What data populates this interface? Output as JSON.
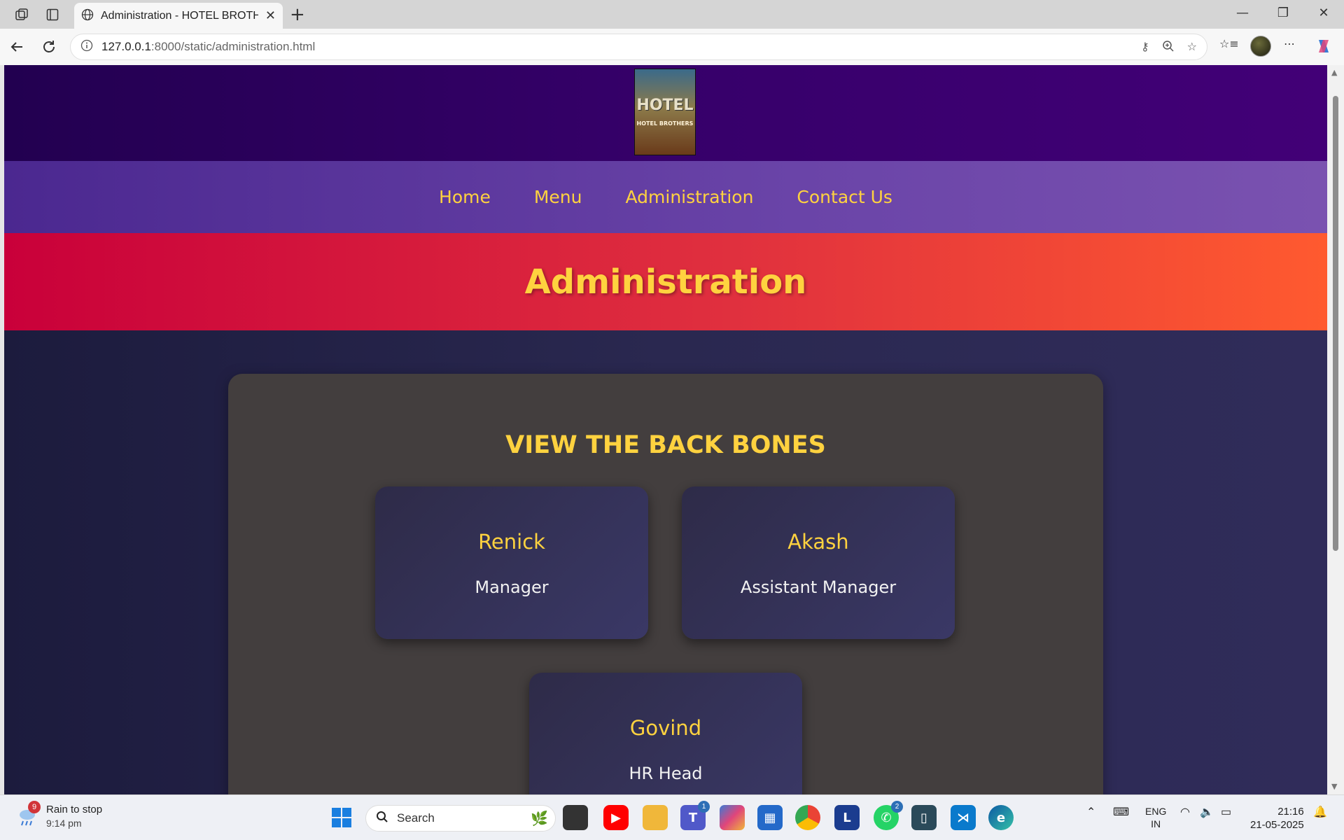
{
  "browser": {
    "tab_title": "Administration - HOTEL BROTHERS",
    "url_host": "127.0.0.1",
    "url_rest": ":8000/static/administration.html"
  },
  "site": {
    "logo_big": "HOTEL",
    "logo_small": "HOTEL BROTHERS",
    "nav": [
      "Home",
      "Menu",
      "Administration",
      "Contact Us"
    ],
    "banner_title": "Administration",
    "section_title": "VIEW THE BACK BONES",
    "team": [
      {
        "name": "Renick",
        "role": "Manager"
      },
      {
        "name": "Akash",
        "role": "Assistant Manager"
      },
      {
        "name": "Govind",
        "role": "HR Head"
      }
    ],
    "colors": {
      "accent_yellow": "#ffd23f",
      "header_purple": "#36006a",
      "nav_purple": "#6a44a8",
      "banner_red": "#e0303e",
      "panel_bg": "#433e3e"
    }
  },
  "taskbar": {
    "weather_badge": "9",
    "weather_main": "Rain to stop",
    "weather_sub": "9:14 pm",
    "search_placeholder": "Search",
    "teams_badge": "1",
    "whatsapp_badge": "2",
    "lang_1": "ENG",
    "lang_2": "IN",
    "time": "21:16",
    "date": "21-05-2025"
  }
}
